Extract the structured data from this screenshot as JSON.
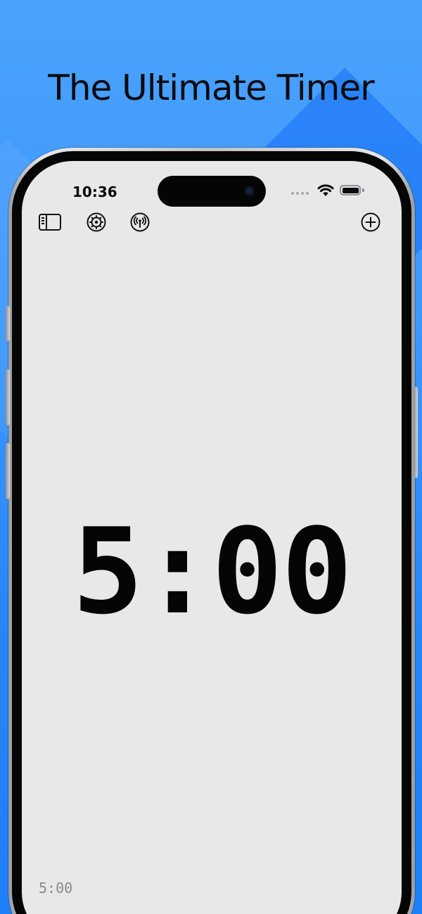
{
  "headline": "The Ultimate Timer",
  "status_bar": {
    "time": "10:36",
    "icons": [
      "signal-dots-icon",
      "wifi-icon",
      "battery-icon"
    ]
  },
  "toolbar": {
    "left_icons": [
      "sidebar-icon",
      "settings-gear-icon",
      "broadcast-icon"
    ],
    "right_icons": [
      "add-circle-icon"
    ]
  },
  "timer": {
    "display": "5:00",
    "secondary_display": "5:00"
  },
  "colors": {
    "background": "#2a8cff",
    "screen": "#e8e8e9",
    "timer_text": "#050505",
    "secondary_text": "#8a8a8e"
  }
}
